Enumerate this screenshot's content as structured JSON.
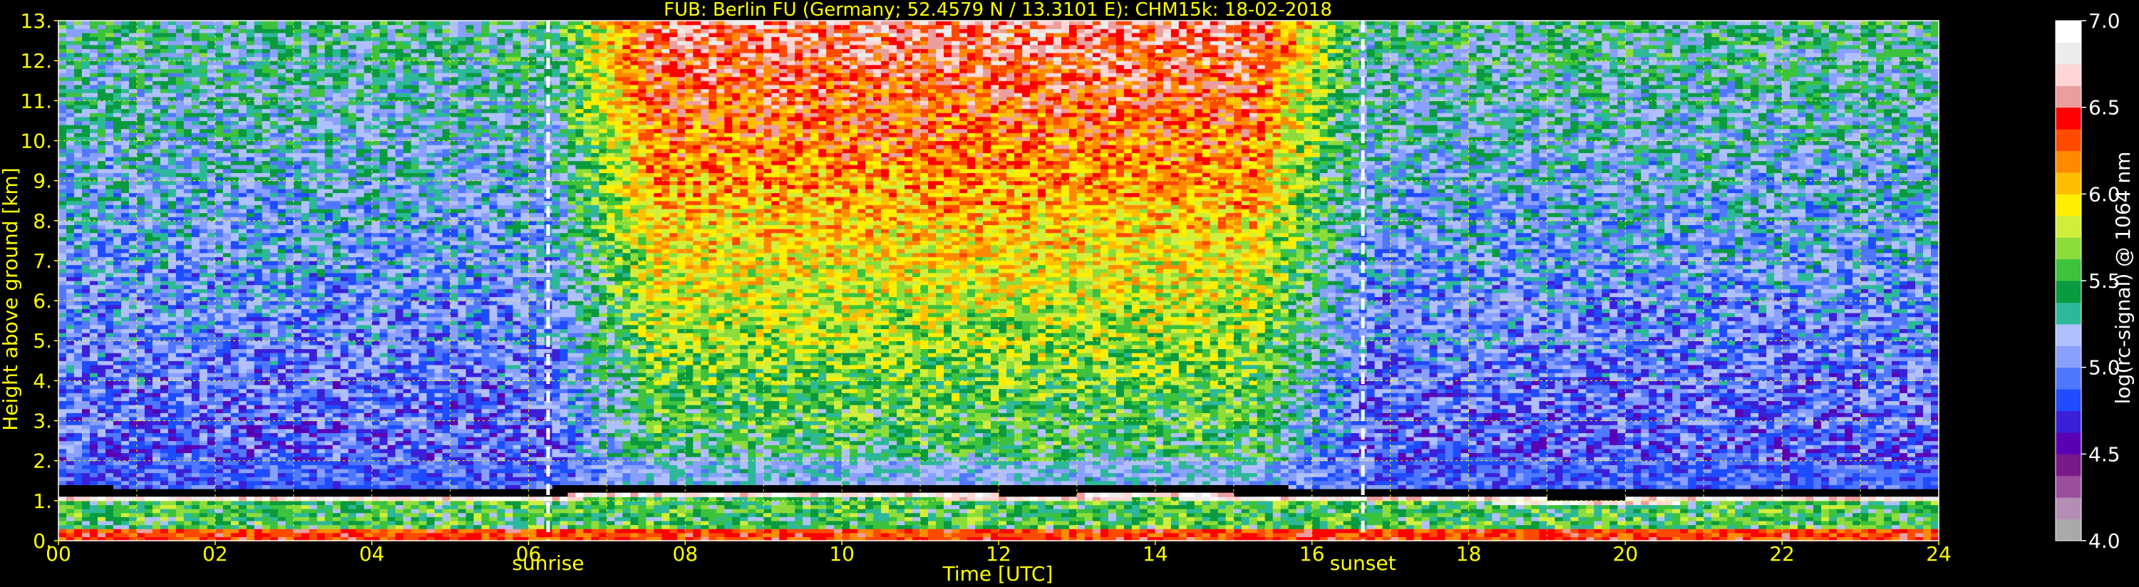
{
  "chart_data": {
    "type": "heatmap",
    "title": "FUB: Berlin FU (Germany; 52.4579 N / 13.3101 E):    CHM15k: 18-02-2018",
    "xlabel": "Time [UTC]",
    "ylabel": "Height above ground [km]",
    "xlim": [
      0,
      24
    ],
    "ylim": [
      0,
      13
    ],
    "x_ticks": [
      "00",
      "02",
      "04",
      "06",
      "08",
      "10",
      "12",
      "14",
      "16",
      "18",
      "20",
      "22",
      "24"
    ],
    "y_ticks": [
      "0.",
      "1.",
      "2.",
      "3.",
      "4.",
      "5.",
      "6.",
      "7.",
      "8.",
      "9.",
      "10.",
      "11.",
      "12.",
      "13."
    ],
    "grid": true,
    "colorbar": {
      "label": "log(rc-signal) @ 1064 nm",
      "range": [
        4.0,
        7.0
      ],
      "ticks": [
        "4.0",
        "4.5",
        "5.0",
        "5.5",
        "6.0",
        "6.5",
        "7.0"
      ]
    },
    "annotations": [
      {
        "label": "sunrise",
        "time": 6.25
      },
      {
        "label": "sunset",
        "time": 16.65
      }
    ],
    "boundary_layer_top_km": [
      [
        0,
        1.15
      ],
      [
        1,
        1.12
      ],
      [
        2,
        1.1
      ],
      [
        3,
        1.12
      ],
      [
        4,
        1.1
      ],
      [
        5,
        1.08
      ],
      [
        6,
        1.1
      ],
      [
        7,
        1.2
      ],
      [
        8,
        1.2
      ],
      [
        9,
        1.18
      ],
      [
        10,
        1.2
      ],
      [
        11,
        1.18
      ],
      [
        12,
        1.15
      ],
      [
        13,
        1.15
      ],
      [
        14,
        1.18
      ],
      [
        15,
        1.15
      ],
      [
        16,
        1.12
      ],
      [
        17,
        1.1
      ],
      [
        18,
        1.08
      ],
      [
        19,
        1.05
      ],
      [
        20,
        1.05
      ],
      [
        21,
        1.08
      ],
      [
        22,
        1.1
      ],
      [
        23,
        1.1
      ],
      [
        24,
        1.12
      ]
    ]
  },
  "colors": {
    "background": "#000000",
    "text": "#ffff00",
    "colorbar_text": "#ffffff",
    "grid": "#ffff00",
    "annotation_line": "#ffffff",
    "colormap": [
      "#a9a9a9",
      "#b48cb4",
      "#9b4f9b",
      "#7a1a8a",
      "#5a00b4",
      "#3a20d8",
      "#1f4cff",
      "#5078ff",
      "#8aa0ff",
      "#b0c0ff",
      "#2db89a",
      "#0a9a40",
      "#3cc23c",
      "#8cdc3c",
      "#d2ee3c",
      "#ffee00",
      "#ffbf00",
      "#ff8a00",
      "#ff4a00",
      "#ff0000",
      "#ec9e9e",
      "#ffd5d5",
      "#ececec",
      "#ffffff"
    ]
  }
}
